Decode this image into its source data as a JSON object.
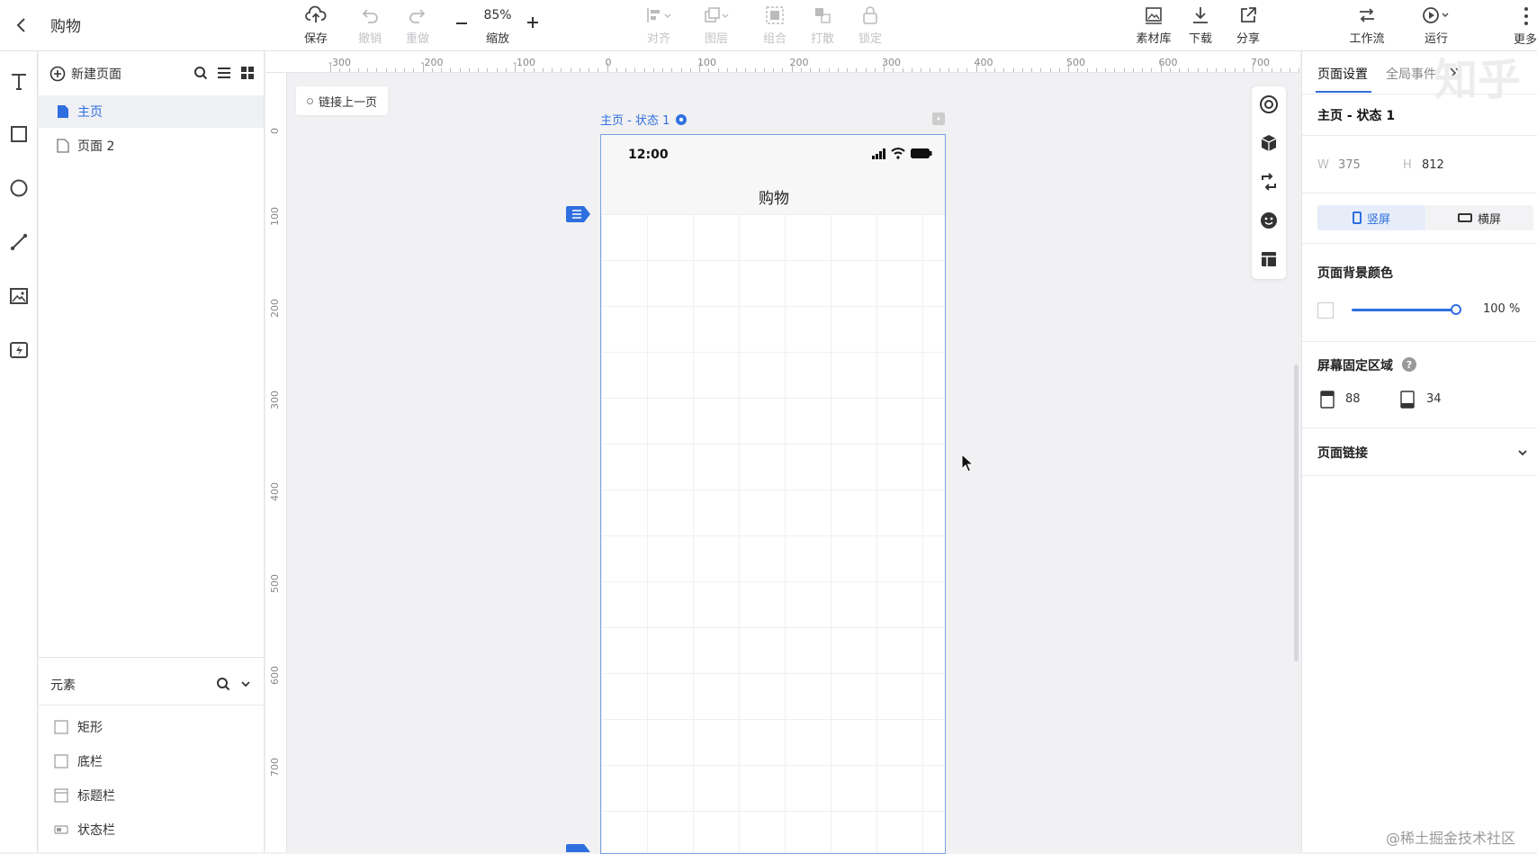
{
  "app": {
    "back_icon": "chevron-left-icon",
    "title": "购物"
  },
  "toolbar": {
    "save": "保存",
    "undo": "撤销",
    "redo": "重做",
    "zoom_value": "85%",
    "zoom_label": "缩放",
    "align": "对齐",
    "layer": "图层",
    "group": "组合",
    "ungroup": "打散",
    "lock": "锁定",
    "assets": "素材库",
    "download": "下载",
    "share": "分享",
    "workflow": "工作流",
    "run": "运行",
    "more": "更多"
  },
  "pages_panel": {
    "new_page": "新建页面",
    "pages": [
      {
        "label": "主页",
        "active": true
      },
      {
        "label": "页面 2",
        "active": false
      }
    ]
  },
  "elements_panel": {
    "title": "元素",
    "items": [
      {
        "label": "矩形",
        "icon": "rectangle-icon"
      },
      {
        "label": "底栏",
        "icon": "rectangle-icon"
      },
      {
        "label": "标题栏",
        "icon": "titlebar-icon"
      },
      {
        "label": "状态栏",
        "icon": "statusbar-icon"
      }
    ]
  },
  "rulers": {
    "h_ticks": [
      "-300",
      "-200",
      "-100",
      "0",
      "100",
      "200",
      "300",
      "400",
      "500",
      "600",
      "700"
    ],
    "v_ticks": [
      "0",
      "100",
      "200",
      "300",
      "400",
      "500",
      "600",
      "700"
    ]
  },
  "canvas": {
    "link_prev": "链接上一页",
    "frame_label": "主页 - 状态 1",
    "phone": {
      "time": "12:00",
      "title": "购物"
    }
  },
  "right_panel": {
    "tab_page": "页面设置",
    "tab_global": "全局事件",
    "state_name": "主页 - 状态 1",
    "w_label": "W",
    "w_value": "375",
    "h_label": "H",
    "h_value": "812",
    "portrait": "竖屏",
    "landscape": "横屏",
    "bg_color_label": "页面背景颜色",
    "bg_opacity": "100 %",
    "fixed_area_label": "屏幕固定区域",
    "fixed_top": "88",
    "fixed_bottom": "34",
    "page_link": "页面链接"
  },
  "colors": {
    "accent": "#2f6fe0",
    "frame_border": "#7aa1e0",
    "panel_active": "#eef3fd"
  },
  "watermark": "@稀土掘金技术社区",
  "corner_logo": "知乎"
}
